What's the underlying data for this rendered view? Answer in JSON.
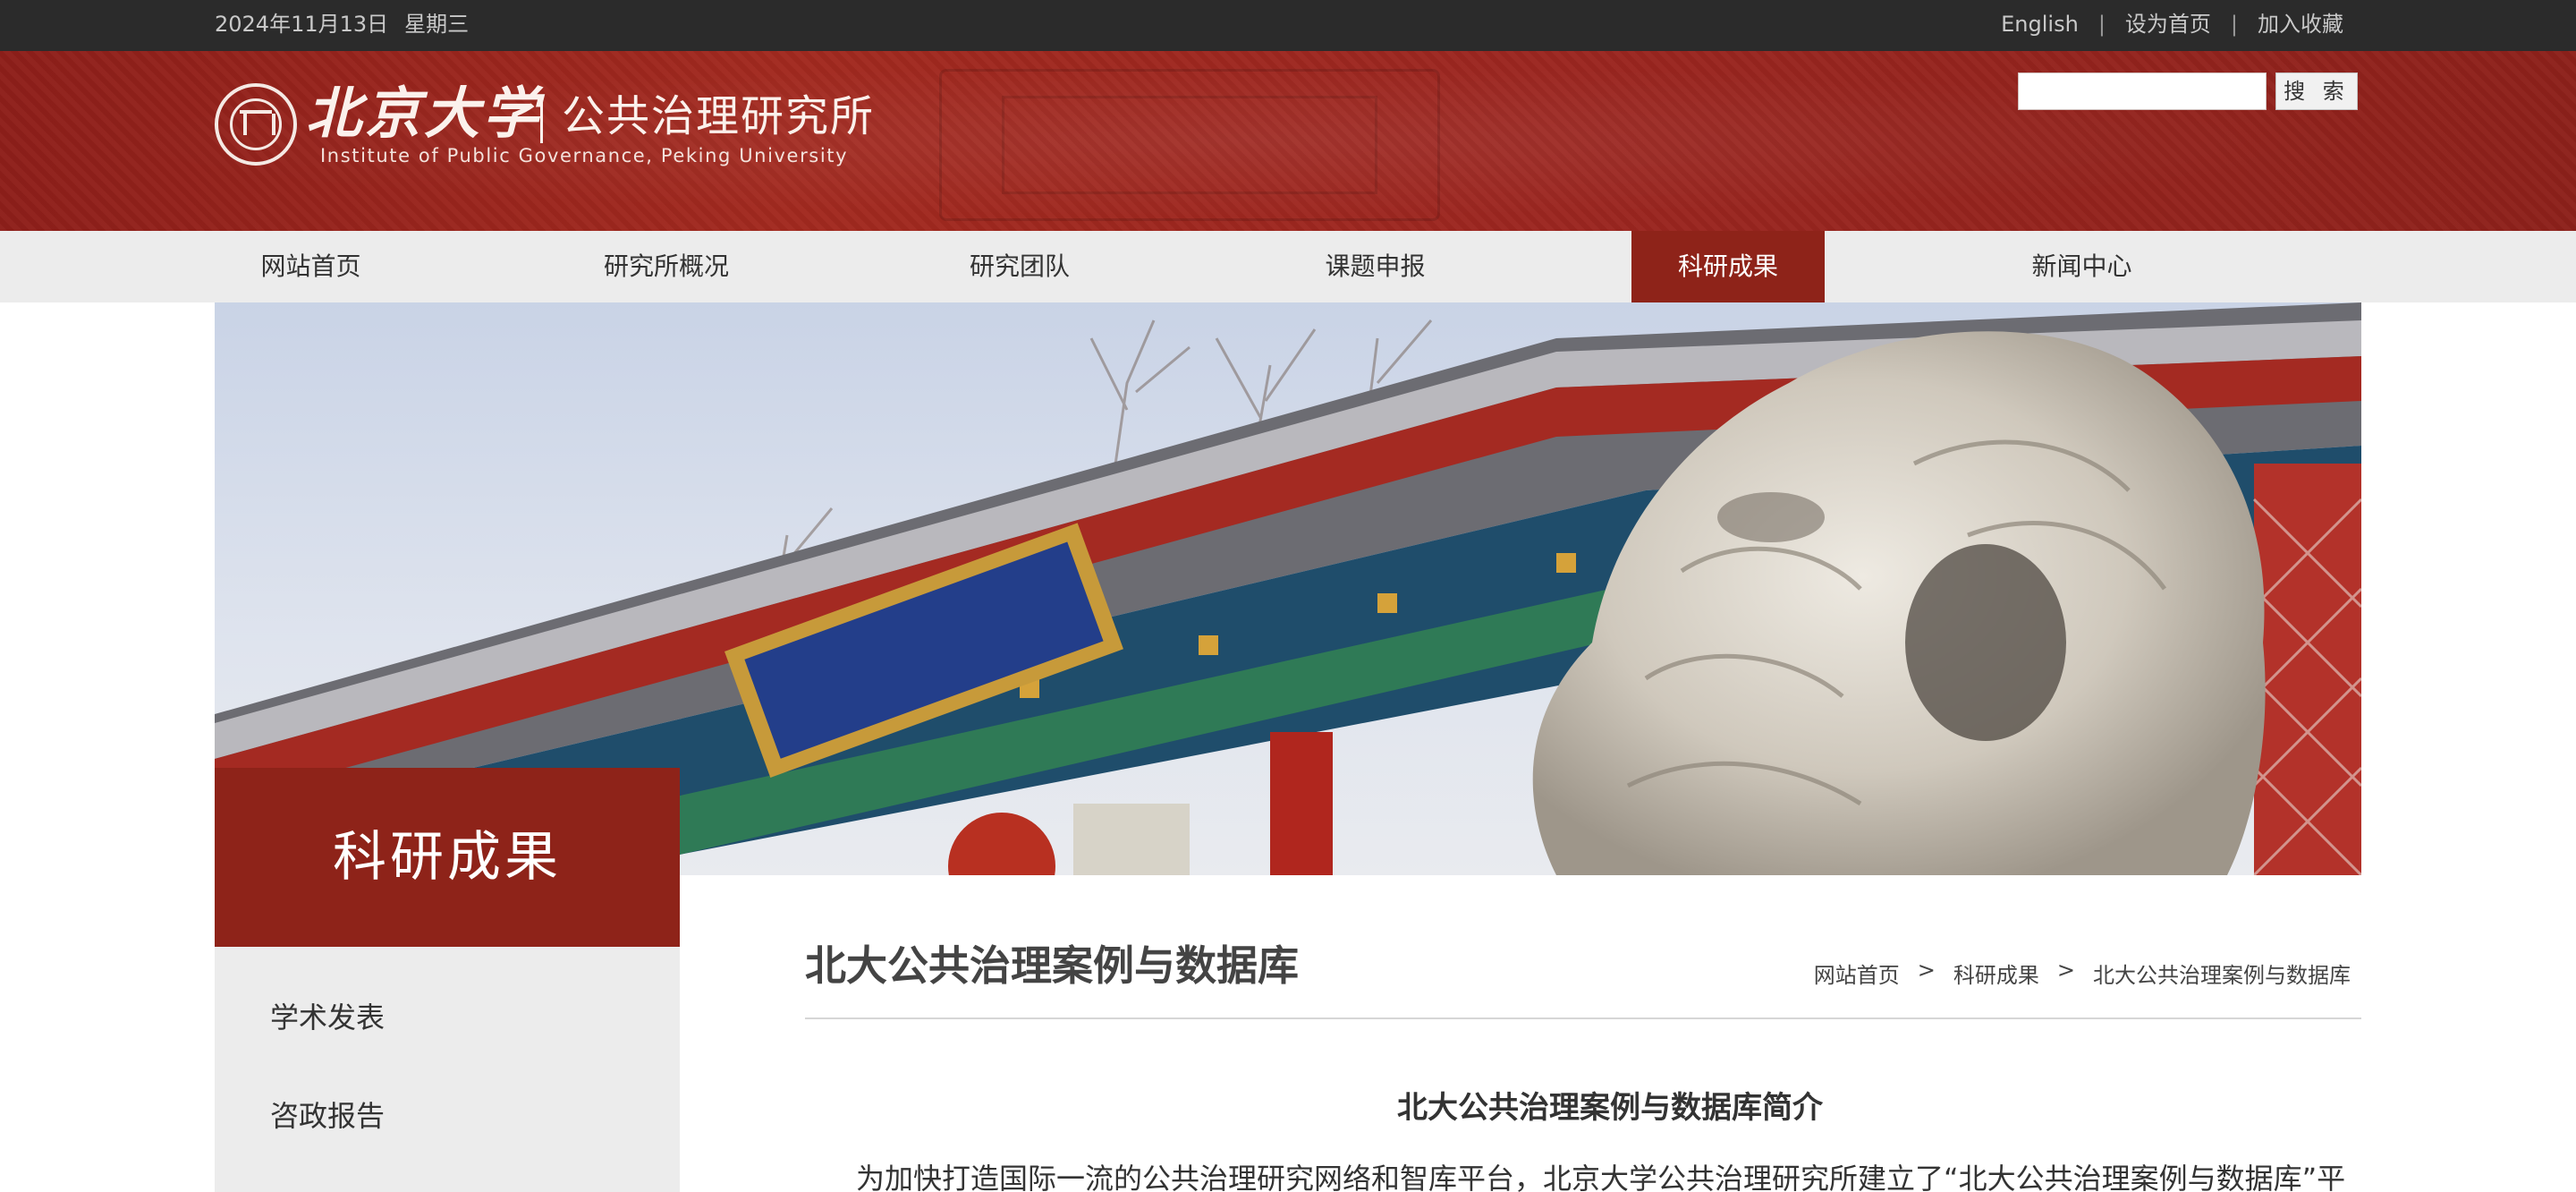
{
  "topbar": {
    "date": "2024年11月13日",
    "weekday": "星期三",
    "links": [
      "English",
      "设为首页",
      "加入收藏"
    ],
    "separator": "|"
  },
  "header": {
    "logo_cn": "北京大学",
    "logo_institute": "公共治理研究所",
    "logo_en": "Institute of Public Governance, Peking University",
    "search_placeholder": "",
    "search_button": "搜 索"
  },
  "nav": {
    "items": [
      "网站首页",
      "研究所概况",
      "研究团队",
      "课题申报",
      "科研成果",
      "新闻中心"
    ],
    "active": "科研成果"
  },
  "sidebar": {
    "title": "科研成果",
    "items": [
      "学术发表",
      "咨政报告"
    ]
  },
  "content": {
    "title": "北大公共治理案例与数据库",
    "breadcrumb": [
      "网站首页",
      "科研成果",
      "北大公共治理案例与数据库"
    ],
    "breadcrumb_sep": ">",
    "article_title": "北大公共治理案例与数据库简介",
    "article_first_line": "为加快打造国际一流的公共治理研究网络和智库平台，北京大学公共治理研究所建立了“北大公共治理案例与数据库”平"
  },
  "colors": {
    "brand_red": "#8e2319",
    "topbar_bg": "#2b2b2b",
    "nav_bg": "#ececec",
    "sidebar_bg": "#ececec"
  }
}
